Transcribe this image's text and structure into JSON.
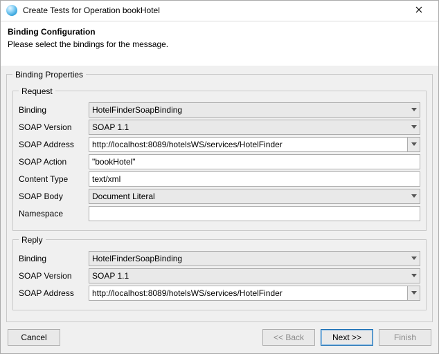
{
  "window": {
    "title": "Create Tests for Operation bookHotel"
  },
  "banner": {
    "heading": "Binding Configuration",
    "subtext": "Please select the bindings for the message."
  },
  "bindingProperties": {
    "legend": "Binding Properties",
    "request": {
      "legend": "Request",
      "labels": {
        "binding": "Binding",
        "soapVersion": "SOAP Version",
        "soapAddress": "SOAP Address",
        "soapAction": "SOAP Action",
        "contentType": "Content Type",
        "soapBody": "SOAP Body",
        "namespace": "Namespace"
      },
      "values": {
        "binding": "HotelFinderSoapBinding",
        "soapVersion": "SOAP 1.1",
        "soapAddress": "http://localhost:8089/hotelsWS/services/HotelFinder",
        "soapAction": "\"bookHotel\"",
        "contentType": "text/xml",
        "soapBody": "Document Literal",
        "namespace": ""
      }
    },
    "reply": {
      "legend": "Reply",
      "labels": {
        "binding": "Binding",
        "soapVersion": "SOAP Version",
        "soapAddress": "SOAP Address"
      },
      "values": {
        "binding": "HotelFinderSoapBinding",
        "soapVersion": "SOAP 1.1",
        "soapAddress": "http://localhost:8089/hotelsWS/services/HotelFinder"
      }
    }
  },
  "buttons": {
    "cancel": "Cancel",
    "back": "<< Back",
    "next": "Next >>",
    "finish": "Finish"
  }
}
